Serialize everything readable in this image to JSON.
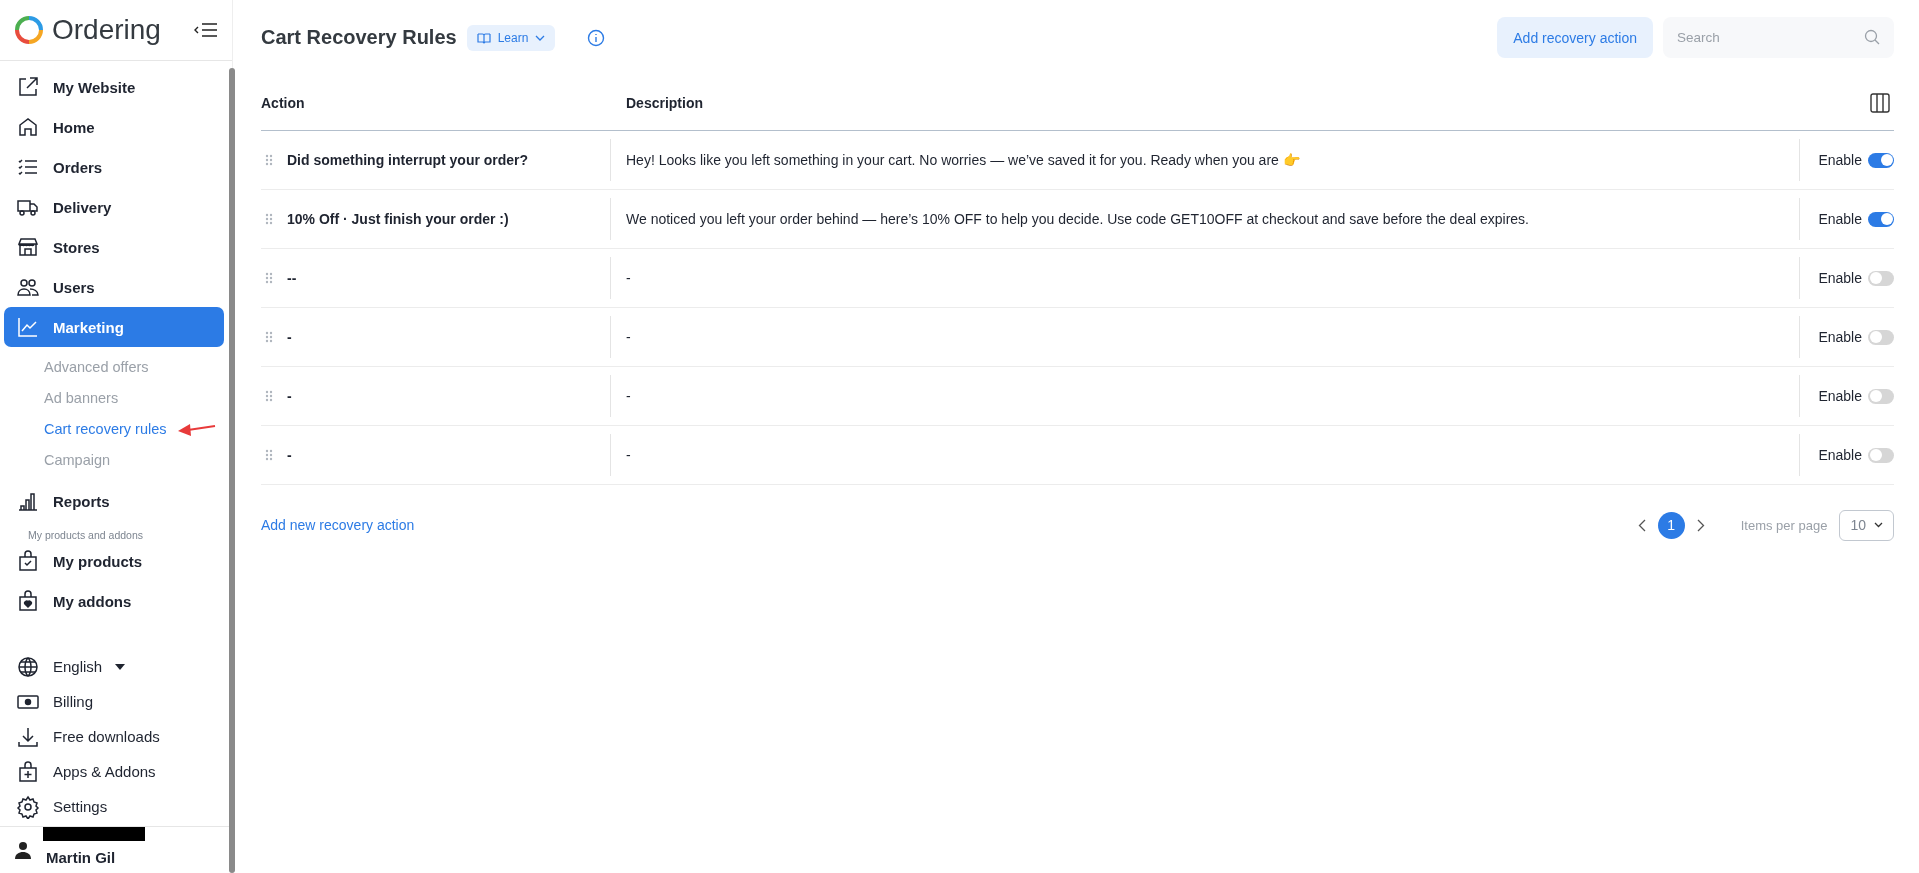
{
  "sidebar": {
    "brand": "Ordering",
    "items": [
      {
        "label": "My Website",
        "selected": false
      },
      {
        "label": "Home",
        "selected": false
      },
      {
        "label": "Orders",
        "selected": false
      },
      {
        "label": "Delivery",
        "selected": false
      },
      {
        "label": "Stores",
        "selected": false
      },
      {
        "label": "Users",
        "selected": false
      },
      {
        "label": "Marketing",
        "selected": true,
        "children": [
          {
            "label": "Advanced offers",
            "selected": false
          },
          {
            "label": "Ad banners",
            "selected": false
          },
          {
            "label": "Cart recovery rules",
            "selected": true
          },
          {
            "label": "Campaign",
            "selected": false
          }
        ]
      },
      {
        "label": "Reports",
        "selected": false
      }
    ],
    "section_label": "My products and addons",
    "section_items": [
      {
        "label": "My products",
        "selected": false
      },
      {
        "label": "My addons",
        "selected": false
      }
    ],
    "footer_items": [
      {
        "label": "English",
        "dropdown": true
      },
      {
        "label": "Billing",
        "dropdown": false
      },
      {
        "label": "Free downloads",
        "dropdown": false
      },
      {
        "label": "Apps & Addons",
        "dropdown": false
      },
      {
        "label": "Settings",
        "dropdown": false
      }
    ],
    "user": "Martin Gil"
  },
  "header": {
    "title": "Cart Recovery Rules",
    "learn": "Learn",
    "add_button": "Add recovery action",
    "search": {
      "placeholder": "Search"
    }
  },
  "table": {
    "columns": [
      "Action",
      "Description"
    ],
    "rows": [
      {
        "action": "Did something interrupt your order?",
        "description": "Hey! Looks like you left something in your cart. No worries — we’ve saved it for you. Ready when you are 👉",
        "toggle_label": "Enable",
        "on": true
      },
      {
        "action": "10% Off · Just finish your order :)",
        "description": "We noticed you left your order behind — here’s 10% OFF to help you decide. Use code GET10OFF at checkout and save before the deal expires.",
        "toggle_label": "Enable",
        "on": true
      },
      {
        "action": "--",
        "description": "-",
        "toggle_label": "Enable",
        "on": false
      },
      {
        "action": "-",
        "description": "-",
        "toggle_label": "Enable",
        "on": false
      },
      {
        "action": "-",
        "description": "-",
        "toggle_label": "Enable",
        "on": false
      },
      {
        "action": "-",
        "description": "-",
        "toggle_label": "Enable",
        "on": false
      }
    ]
  },
  "footer": {
    "add_link": "Add new recovery action",
    "pages": [
      {
        "label": "1",
        "selected": true
      }
    ],
    "items_per_page_label": "Items per page",
    "items_per_page": "10"
  }
}
